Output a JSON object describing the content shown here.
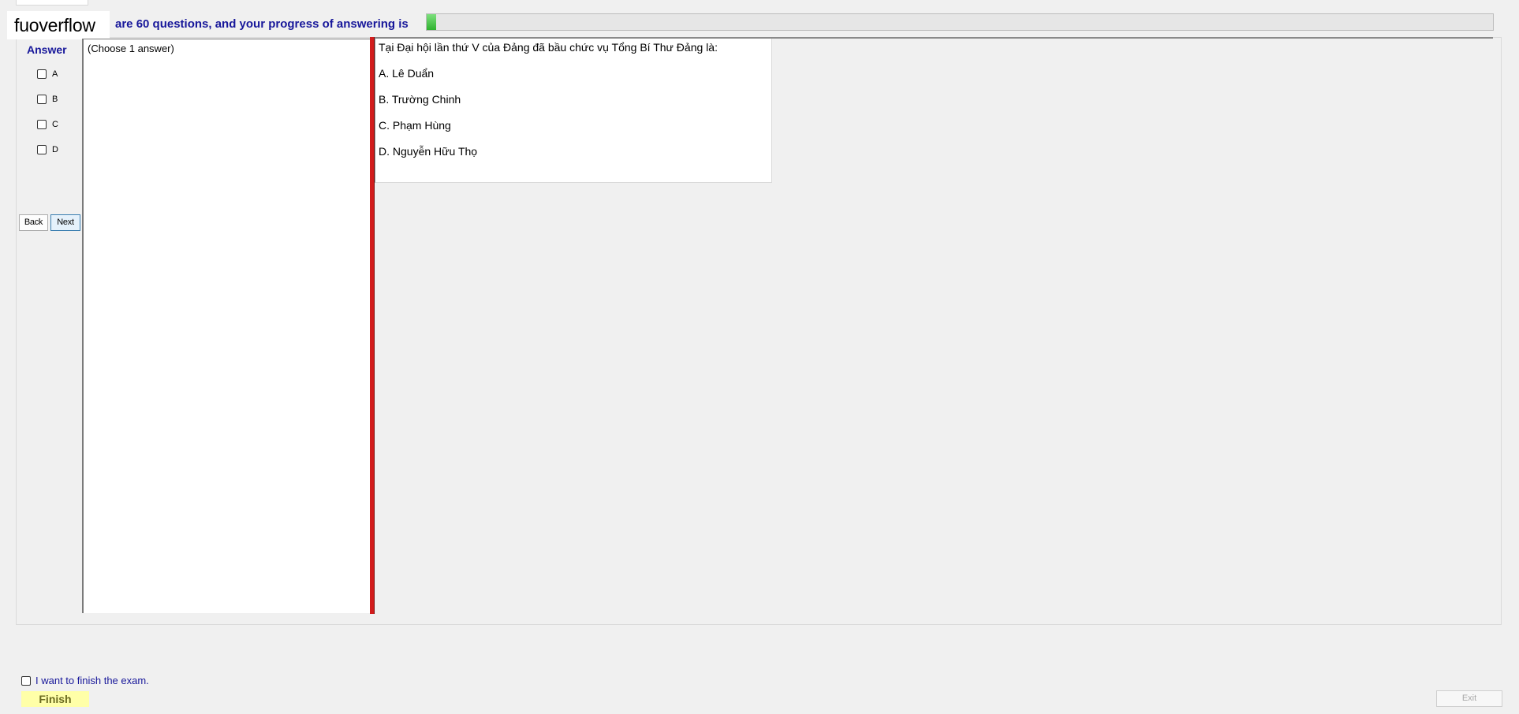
{
  "watermark": "fuoverflow",
  "progress": {
    "text": "are 60 questions, and your progress of answering is",
    "percent": 0.9,
    "fill_color": "#3cc23c"
  },
  "answer_panel": {
    "heading": "Answer",
    "options": [
      "A",
      "B",
      "C",
      "D"
    ]
  },
  "nav": {
    "back_label": "Back",
    "next_label": "Next"
  },
  "instruction": "(Choose 1 answer)",
  "question": {
    "text": "Tại Đại hội lần thứ V của Đảng đã bầu chức vụ Tổng Bí Thư Đảng là:",
    "choices": [
      "A.  Lê Duẩn",
      "B.  Trường Chinh",
      "C.  Phạm Hùng",
      "D.  Nguyễn Hữu Thọ"
    ]
  },
  "footer": {
    "finish_check_label": "I want to finish the exam.",
    "finish_label": "Finish",
    "exit_label": "Exit"
  },
  "colors": {
    "heading_blue": "#17179a",
    "splitter_red": "#d21c1c",
    "finish_yellow": "#ffffa8"
  }
}
